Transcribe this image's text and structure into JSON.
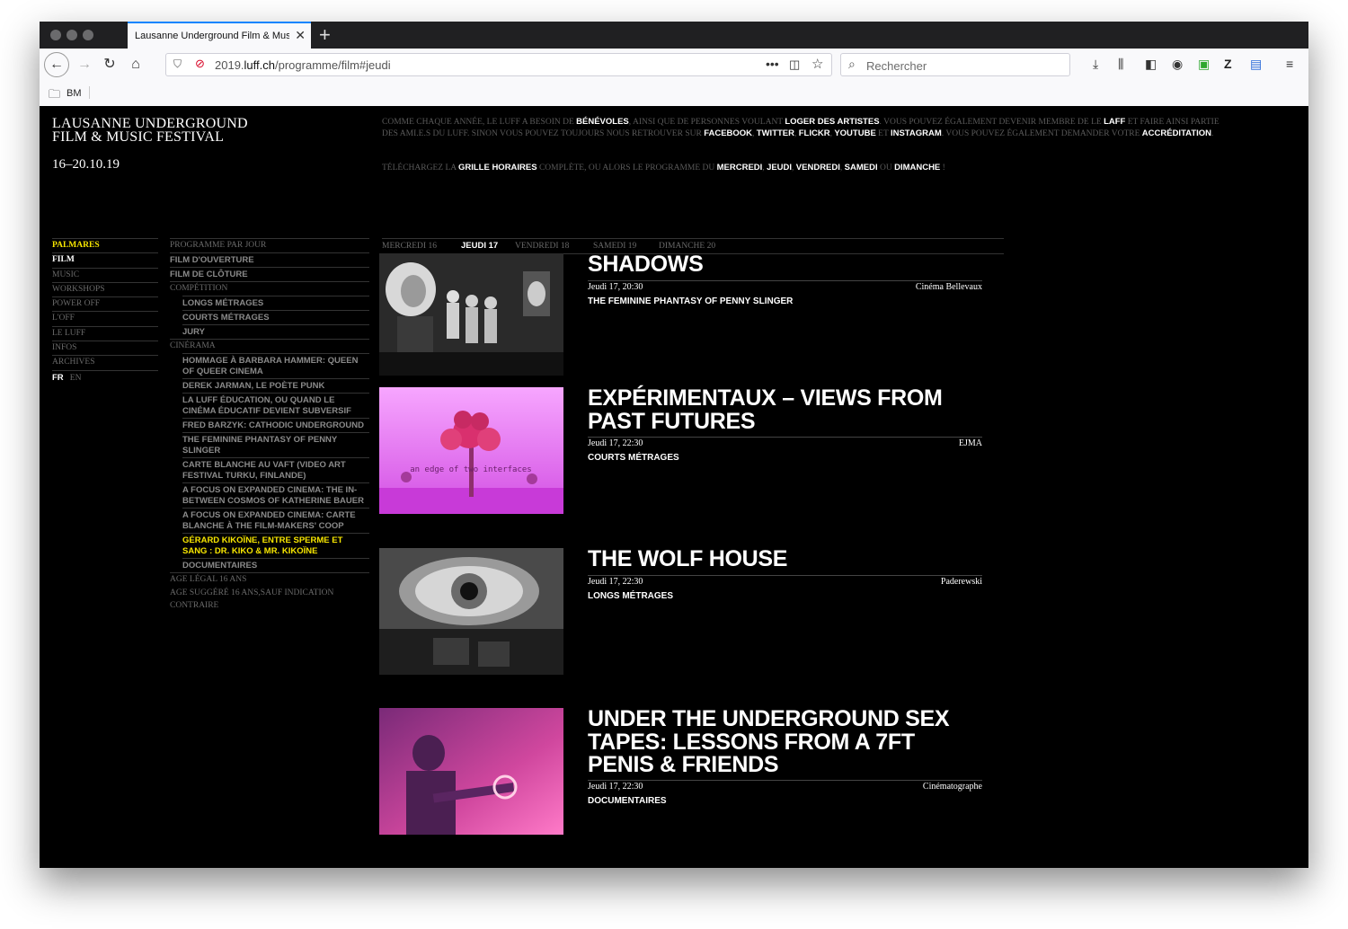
{
  "browser": {
    "tab_title": "Lausanne Underground Film & Music Festival",
    "url_prefix": "2019.",
    "url_domain": "luff.ch",
    "url_path": "/programme/film#jeudi",
    "search_placeholder": "Rechercher",
    "bookmark_folder": "BM"
  },
  "site": {
    "title_line1": "LAUSANNE UNDERGROUND",
    "title_line2": "FILM & MUSIC FESTIVAL",
    "dates": "16–20.10.19"
  },
  "intro": {
    "t1": "COMME CHAQUE ANNÉE, LE LUFF A BESOIN DE ",
    "l1": "BÉNÉVOLES",
    "t2": ", AINSI QUE DE PERSONNES VOULANT ",
    "l2": "LOGER DES ARTISTES",
    "t3": ". VOUS POUVEZ ÉGALEMENT DEVENIR MEMBRE DE LE ",
    "l3": "LAFF",
    "t4": " ET FAIRE AINSI PARTIE DES AMI.E.S DU LUFF. SINON VOUS POUVEZ TOUJOURS NOUS RETROUVER SUR ",
    "l4": "FACEBOOK",
    "t5": ", ",
    "l5": "TWITTER",
    "t6": ", ",
    "l6": "FLICKR",
    "t7": ", ",
    "l7": "YOUTUBE",
    "t8": " ET ",
    "l8": "INSTAGRAM",
    "t9": ". VOUS POUVEZ ÉGALEMENT DEMANDER VOTRE ",
    "l9": "ACCRÉDITATION",
    "t10": ".",
    "d1": "TÉLÉCHARGEZ LA ",
    "dl1": "GRILLE HORAIRES",
    "d2": " COMPLÈTE, OU ALORS LE PROGRAMME DU ",
    "dl2": "MERCREDI",
    "d3": ", ",
    "dl3": "JEUDI",
    "d4": ", ",
    "dl4": "VENDREDI",
    "d5": ", ",
    "dl5": "SAMEDI",
    "d6": " OU ",
    "dl6": "DIMANCHE",
    "d7": " !"
  },
  "mainnav": [
    "PALMARES",
    "FILM",
    "MUSIC",
    "WORKSHOPS",
    "POWER OFF",
    "L'OFF",
    "LE LUFF",
    "INFOS",
    "ARCHIVES"
  ],
  "lang": {
    "fr": "FR",
    "en": "EN"
  },
  "subnav": {
    "s0": "PROGRAMME PAR JOUR",
    "s1": "FILM D'OUVERTURE",
    "s2": "FILM DE CLÔTURE",
    "s3": "COMPÉTITION",
    "s4": "LONGS MÉTRAGES",
    "s5": "COURTS MÉTRAGES",
    "s6": "JURY",
    "s7": "CINÉRAMA",
    "s8": "HOMMAGE À BARBARA HAMMER: QUEEN OF QUEER CINEMA",
    "s9": "DEREK JARMAN, LE POÈTE PUNK",
    "s10": "LA LUFF ÉDUCATION, OU QUAND LE CINÉMA ÉDUCATIF DEVIENT SUBVERSIF",
    "s11": "FRED BARZYK: CATHODIC UNDERGROUND",
    "s12": "THE FEMININE PHANTASY OF PENNY SLINGER",
    "s13": "CARTE BLANCHE AU VAFT (VIDEO ART FESTIVAL TURKU, FINLANDE)",
    "s14": "A FOCUS ON EXPANDED CINEMA: THE IN-BETWEEN COSMOS OF KATHERINE BAUER",
    "s15": "A FOCUS ON EXPANDED CINEMA: CARTE BLANCHE À THE FILM-MAKERS' COOP",
    "s16": "GÉRARD KIKOÏNE, ENTRE SPERME ET SANG : DR. KIKO & MR. KIKOÏNE",
    "s17": "DOCUMENTAIRES",
    "s18": "AGE LÉGAL 16 ANS",
    "s19": "AGE SUGGÉRÉ 16 ANS,SAUF INDICATION CONTRAIRE"
  },
  "days": [
    "MERCREDI 16",
    "JEUDI 17",
    "VENDREDI 18",
    "SAMEDI 19",
    "DIMANCHE 20"
  ],
  "entries": [
    {
      "title": "SHADOWS",
      "datetime": "Jeudi 17, 20:30",
      "venue": "Cinéma Bellevaux",
      "category": "THE FEMININE PHANTASY OF PENNY SLINGER"
    },
    {
      "title": "EXPÉRIMENTAUX – VIEWS FROM PAST FUTURES",
      "datetime": "Jeudi 17, 22:30",
      "venue": "EJMA",
      "category": "COURTS MÉTRAGES",
      "thumb_caption": "an edge of two interfaces"
    },
    {
      "title": "THE WOLF HOUSE",
      "datetime": "Jeudi 17, 22:30",
      "venue": "Paderewski",
      "category": "LONGS MÉTRAGES"
    },
    {
      "title": "UNDER THE UNDERGROUND SEX TAPES: LESSONS FROM A 7FT PENIS & FRIENDS",
      "datetime": "Jeudi 17, 22:30",
      "venue": "Cinématographe",
      "category": "DOCUMENTAIRES"
    }
  ],
  "colors": {
    "highlight": "#f7e600",
    "tab_accent": "#0a84ff"
  }
}
